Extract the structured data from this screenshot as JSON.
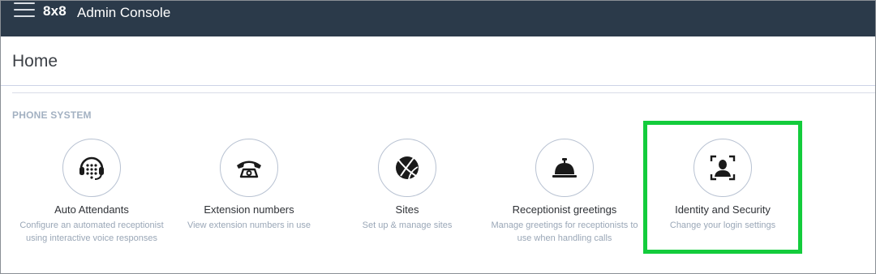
{
  "header": {
    "menu_icon": "hamburger-icon",
    "brand": "8x8",
    "title": "Admin Console",
    "background": "#2b3a4a"
  },
  "page": {
    "title": "Home"
  },
  "section": {
    "label": "PHONE SYSTEM"
  },
  "cards": [
    {
      "icon": "headset-icon",
      "title": "Auto Attendants",
      "description": "Configure an automated receptionist using interactive voice responses"
    },
    {
      "icon": "phone-icon",
      "title": "Extension numbers",
      "description": "View extension numbers in use"
    },
    {
      "icon": "globe-icon",
      "title": "Sites",
      "description": "Set up & manage sites"
    },
    {
      "icon": "service-bell-icon",
      "title": "Receptionist greetings",
      "description": "Manage greetings for receptionists to use when handling calls"
    },
    {
      "icon": "user-scan-icon",
      "title": "Identity and Security",
      "description": "Change your login settings"
    }
  ],
  "highlight": {
    "color": "#13cc3c",
    "target": "Identity and Security"
  }
}
